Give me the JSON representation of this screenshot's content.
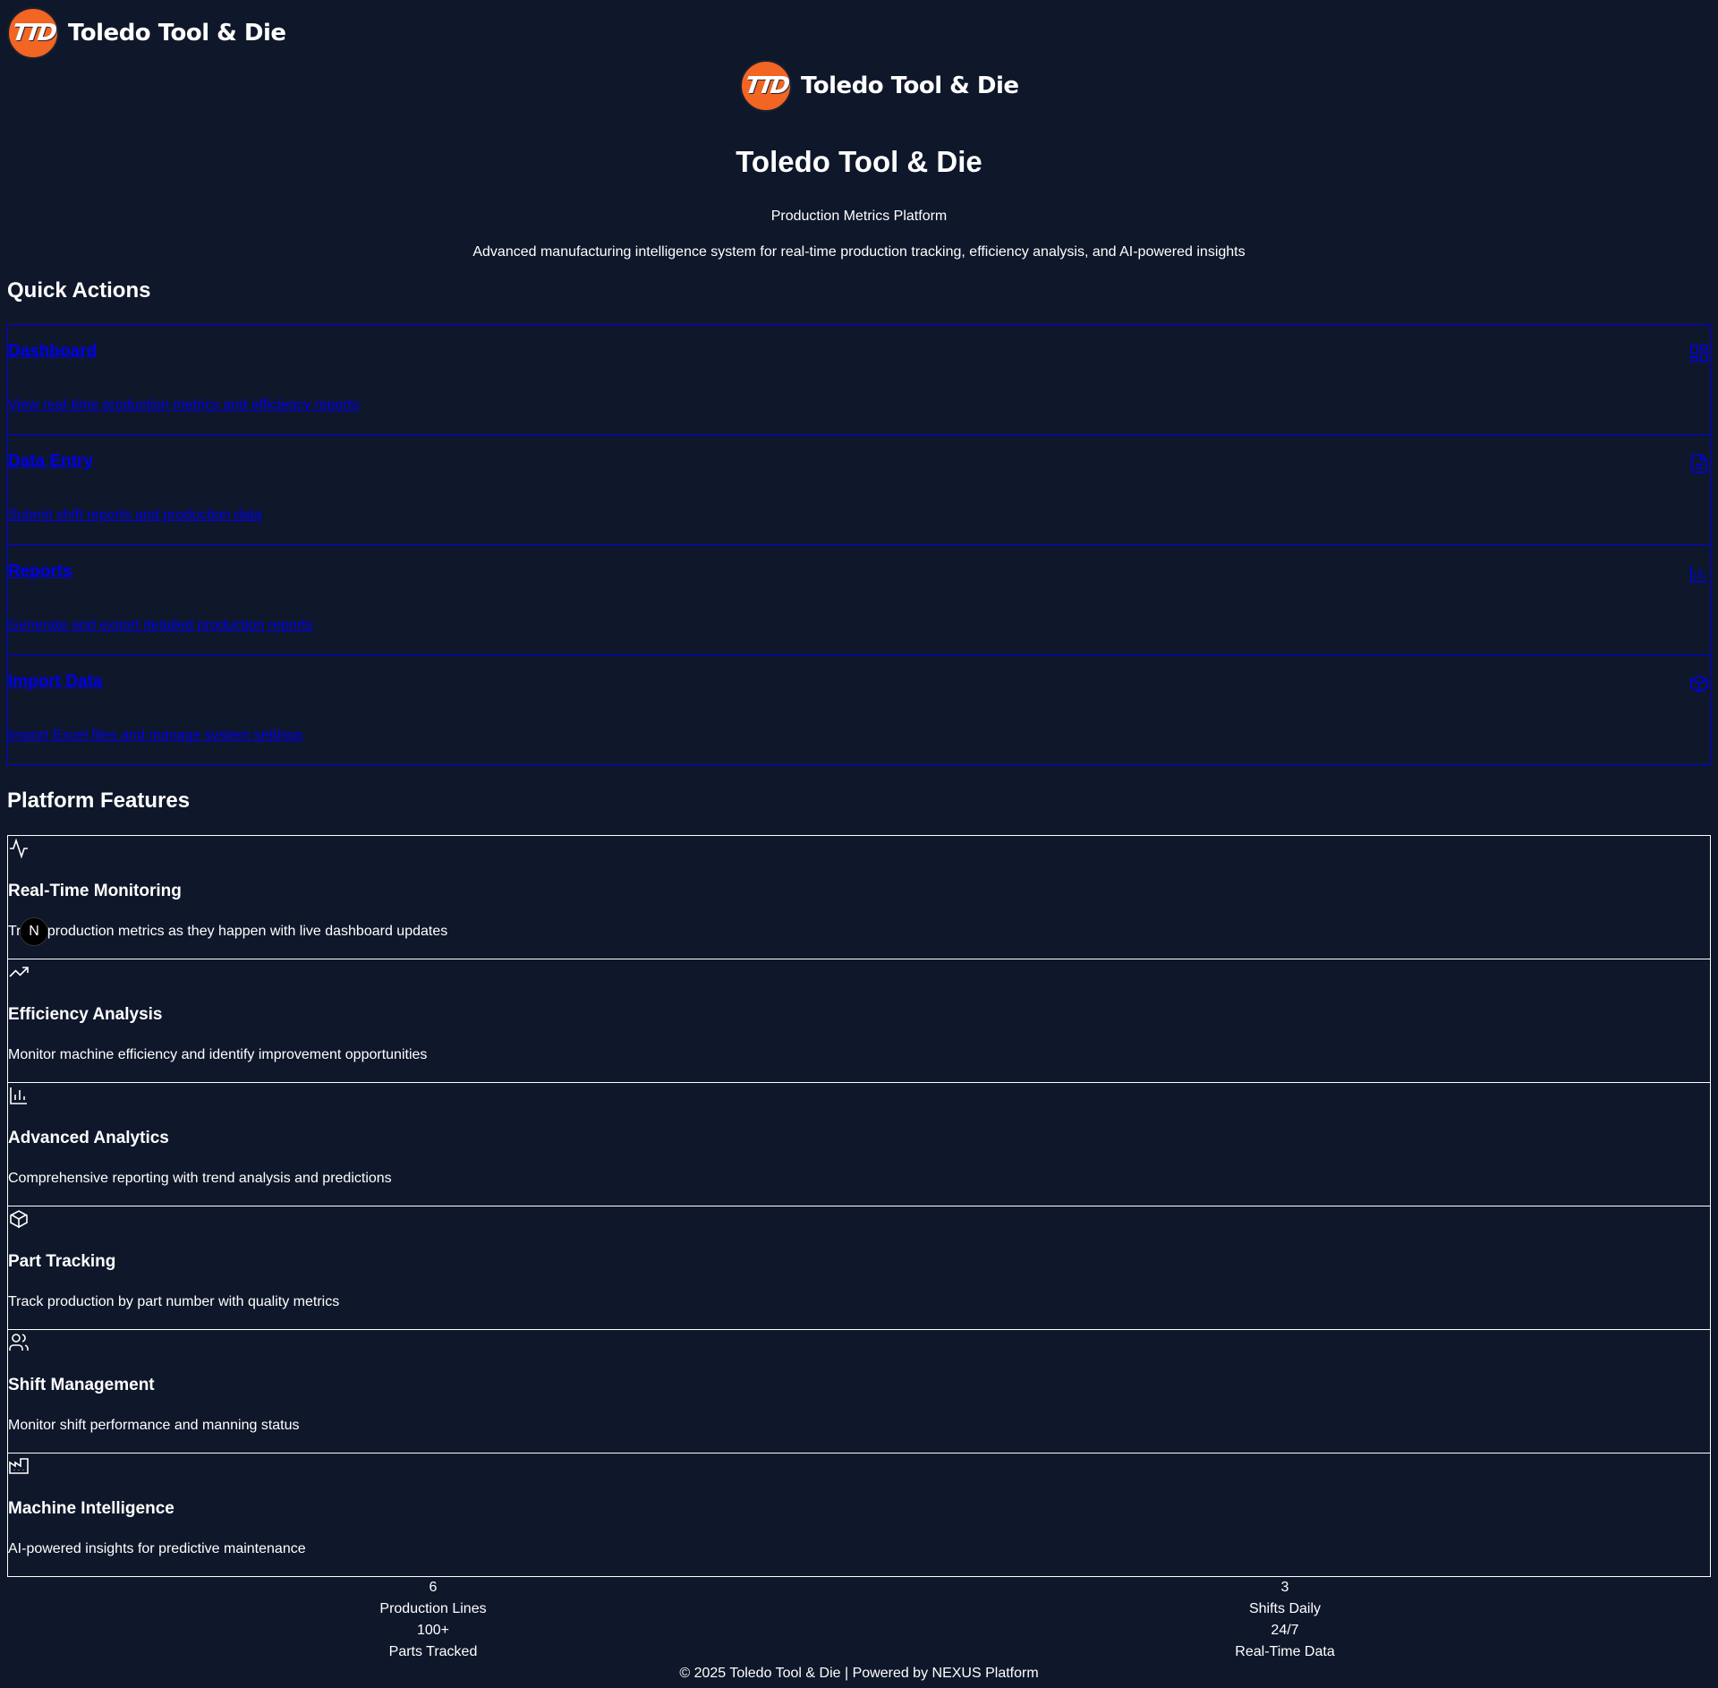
{
  "brand": {
    "name": "Toledo Tool & Die",
    "badge_letters": "TTD",
    "accent_color": "#f26522",
    "background_color": "#0f172a"
  },
  "hero": {
    "title": "Toledo Tool & Die",
    "subtitle": "Production Metrics Platform",
    "description": "Advanced manufacturing intelligence system for real-time production tracking, efficiency analysis, and AI-powered insights"
  },
  "quick_actions": {
    "heading": "Quick Actions",
    "items": [
      {
        "title": "Dashboard",
        "description": "View real-time production metrics and efficiency reports",
        "icon": "dashboard-grid-icon"
      },
      {
        "title": "Data Entry",
        "description": "Submit shift reports and production data",
        "icon": "document-icon"
      },
      {
        "title": "Reports",
        "description": "Generate and export detailed production reports",
        "icon": "bar-chart-icon"
      },
      {
        "title": "Import Data",
        "description": "Import Excel files and manage system settings",
        "icon": "package-icon"
      }
    ],
    "link_color": "#0000ee"
  },
  "features": {
    "heading": "Platform Features",
    "items": [
      {
        "title": "Real-Time Monitoring",
        "description": "Track production metrics as they happen with live dashboard updates",
        "icon": "activity-icon"
      },
      {
        "title": "Efficiency Analysis",
        "description": "Monitor machine efficiency and identify improvement opportunities",
        "icon": "trending-up-icon"
      },
      {
        "title": "Advanced Analytics",
        "description": "Comprehensive reporting with trend analysis and predictions",
        "icon": "bar-chart-icon"
      },
      {
        "title": "Part Tracking",
        "description": "Track production by part number with quality metrics",
        "icon": "package-icon"
      },
      {
        "title": "Shift Management",
        "description": "Monitor shift performance and manning status",
        "icon": "users-icon"
      },
      {
        "title": "Machine Intelligence",
        "description": "AI-powered insights for predictive maintenance",
        "icon": "factory-icon"
      }
    ]
  },
  "stats": [
    {
      "value": "6",
      "label": "Production Lines"
    },
    {
      "value": "3",
      "label": "Shifts Daily"
    },
    {
      "value": "100+",
      "label": "Parts Tracked"
    },
    {
      "value": "24/7",
      "label": "Real-Time Data"
    }
  ],
  "footer": {
    "text": "© 2025 Toledo Tool & Die | Powered by NEXUS Platform"
  },
  "dev_badge": {
    "letter": "N"
  }
}
